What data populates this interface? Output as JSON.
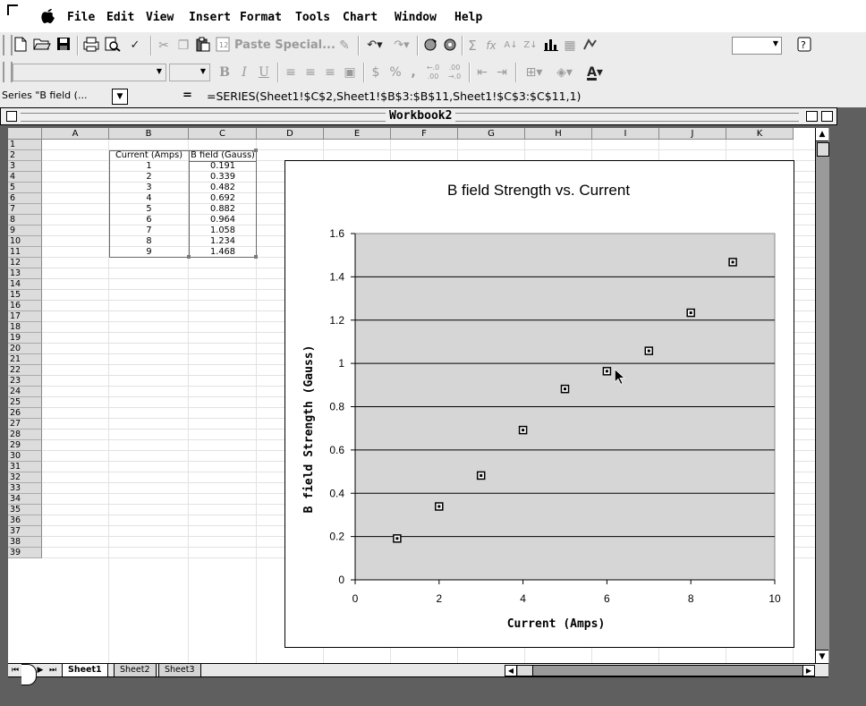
{
  "menu": [
    "File",
    "Edit",
    "View",
    "Insert",
    "Format",
    "Tools",
    "Chart",
    "Window",
    "Help"
  ],
  "toolbar": {
    "paste_special": "Paste Special...",
    "sum_symbol": "Σ",
    "function_symbol": "fx",
    "bold_glyph": "B",
    "italic_glyph": "I",
    "underline_glyph": "U",
    "percent_glyph": "%",
    "comma_glyph": ",",
    "currency_glyph": "$",
    "font_color_glyph": "A"
  },
  "formula_bar": {
    "name_box": "Series \"B field (...",
    "equals": "=",
    "formula": "=SERIES(Sheet1!$C$2,Sheet1!$B$3:$B$11,Sheet1!$C$3:$C$11,1)"
  },
  "workbook": {
    "title": "Workbook2",
    "columns": [
      "A",
      "B",
      "C",
      "D",
      "E",
      "F",
      "G",
      "H",
      "I",
      "J",
      "K"
    ],
    "rows": [
      "1",
      "2",
      "3",
      "4",
      "5",
      "6",
      "7",
      "8",
      "9",
      "10",
      "11",
      "12",
      "13",
      "14",
      "15",
      "16",
      "17",
      "18",
      "19",
      "20",
      "21",
      "22",
      "23",
      "24",
      "25",
      "26",
      "27",
      "28",
      "29",
      "30",
      "31",
      "32",
      "33",
      "34",
      "35",
      "36",
      "37",
      "38",
      "39"
    ],
    "table": {
      "header_b": "Current (Amps)",
      "header_c": "B field (Gauss)",
      "current": [
        "1",
        "2",
        "3",
        "4",
        "5",
        "6",
        "7",
        "8",
        "9"
      ],
      "bfield": [
        "0.191",
        "0.339",
        "0.482",
        "0.692",
        "0.882",
        "0.964",
        "1.058",
        "1.234",
        "1.468"
      ]
    },
    "sheet_tabs": [
      "Sheet1",
      "Sheet2",
      "Sheet3"
    ],
    "active_tab": "Sheet1"
  },
  "chart_data": {
    "type": "scatter",
    "title": "B field Strength vs. Current",
    "xlabel": "Current (Amps)",
    "ylabel": "B field Strength (Gauss)",
    "xlim": [
      0,
      10
    ],
    "ylim": [
      0,
      1.6
    ],
    "xticks": [
      "0",
      "2",
      "4",
      "6",
      "8",
      "10"
    ],
    "yticks": [
      "0",
      "0.2",
      "0.4",
      "0.6",
      "0.8",
      "1",
      "1.2",
      "1.4",
      "1.6"
    ],
    "x": [
      1,
      2,
      3,
      4,
      5,
      6,
      7,
      8,
      9
    ],
    "y": [
      0.191,
      0.339,
      0.482,
      0.692,
      0.882,
      0.964,
      1.058,
      1.234,
      1.468
    ],
    "grid": "horizontal",
    "plot_area_color": "#d6d6d6",
    "legend": "none"
  }
}
